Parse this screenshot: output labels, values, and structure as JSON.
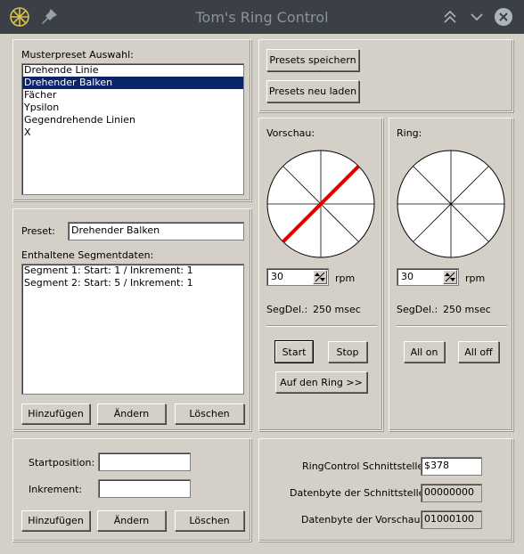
{
  "window": {
    "title": "Tom's Ring Control"
  },
  "presets_panel": {
    "heading": "Musterpreset Auswahl:",
    "items": [
      "Drehende Linie",
      "Drehender Balken",
      "Fächer",
      "Ypsilon",
      "Gegendrehende Linien",
      "X"
    ],
    "selected_index": 1
  },
  "preset_panel": {
    "preset_label": "Preset:",
    "preset_value": "Drehender Balken",
    "segments_heading": "Enthaltene Segmentdaten:",
    "segments": [
      "Segment 1: Start: 1 / Inkrement: 1",
      "Segment 2: Start: 5 / Inkrement: 1"
    ],
    "add_label": "Hinzufügen",
    "change_label": "Ändern",
    "delete_label": "Löschen"
  },
  "segment_panel": {
    "start_label": "Startposition:",
    "start_value": "",
    "increment_label": "Inkrement:",
    "increment_value": "",
    "add_label": "Hinzufügen",
    "change_label": "Ändern",
    "delete_label": "Löschen"
  },
  "toolbar": {
    "save_label": "Presets speichern",
    "reload_label": "Presets neu laden"
  },
  "preview": {
    "heading": "Vorschau:",
    "rpm_value": "30",
    "rpm_unit": "rpm",
    "segdel_label": "SegDel.:",
    "segdel_value": "250 msec",
    "start_label": "Start",
    "stop_label": "Stop",
    "to_ring_label": "Auf den Ring >>",
    "line_color": "#e00000"
  },
  "ring": {
    "heading": "Ring:",
    "rpm_value": "30",
    "rpm_unit": "rpm",
    "segdel_label": "SegDel.:",
    "segdel_value": "250 msec",
    "all_on_label": "All on",
    "all_off_label": "All off"
  },
  "interface": {
    "port_label": "RingControl Schnittstelle:",
    "port_value": "$378",
    "port_byte_label": "Datenbyte der Schnittstelle:",
    "port_byte_value": "00000000",
    "preview_byte_label": "Datenbyte der Vorschau:",
    "preview_byte_value": "01000100"
  }
}
